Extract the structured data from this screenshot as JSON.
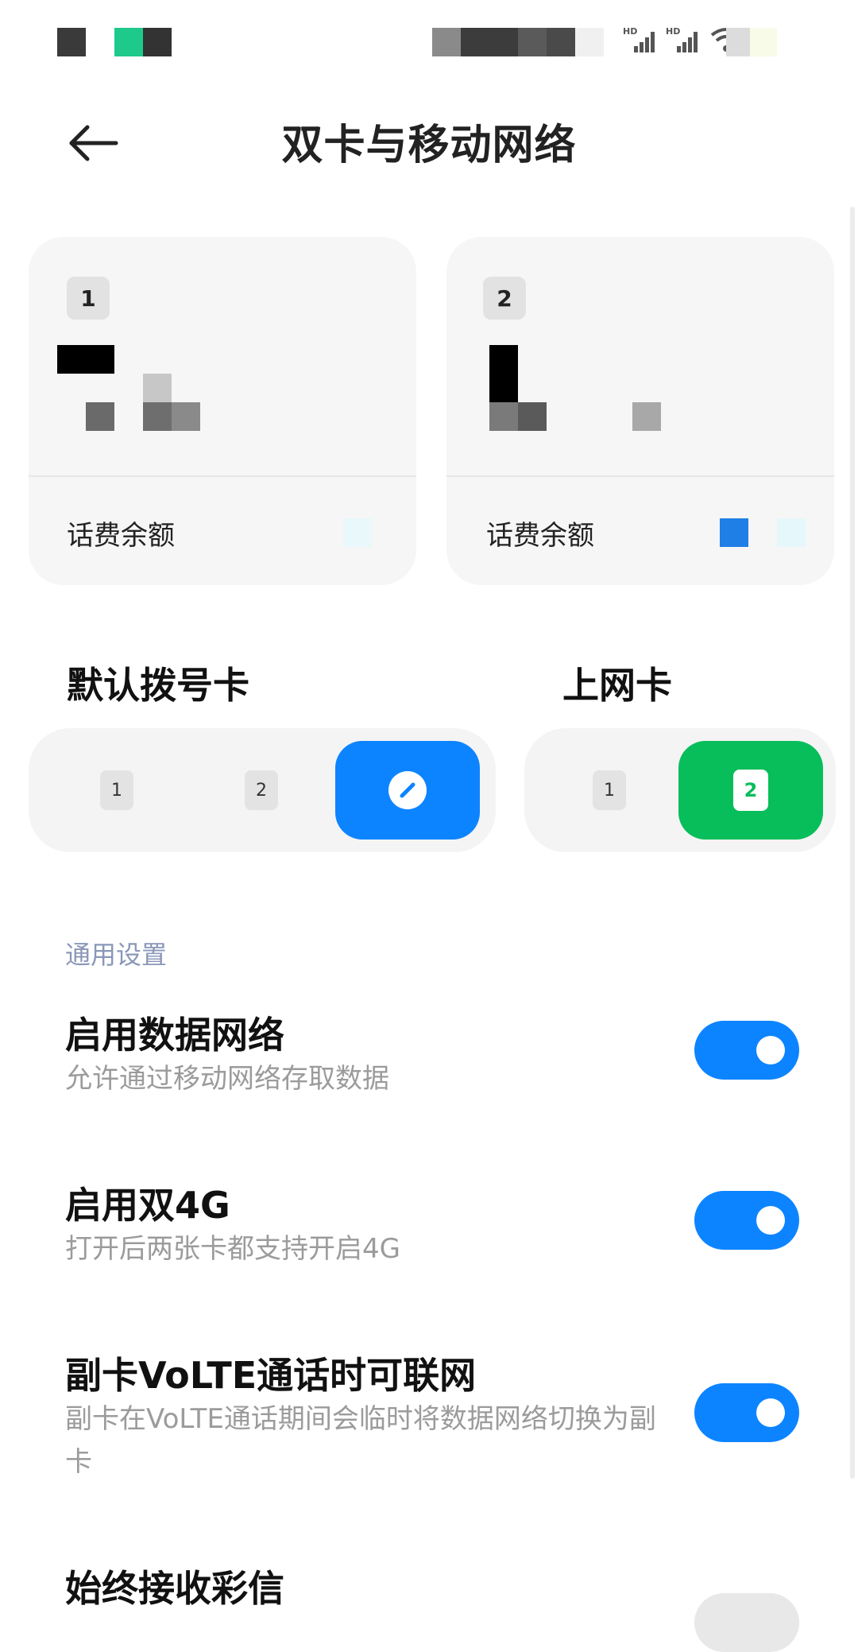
{
  "header": {
    "title": "双卡与移动网络"
  },
  "sims": [
    {
      "slot": "1",
      "balance_label": "话费余额"
    },
    {
      "slot": "2",
      "balance_label": "话费余额"
    }
  ],
  "default_dial": {
    "label": "默认拨号卡",
    "options": [
      "1",
      "2"
    ],
    "selected": "ask"
  },
  "data_sim": {
    "label": "上网卡",
    "options": [
      "1",
      "2"
    ],
    "selected": "2"
  },
  "general": {
    "label": "通用设置",
    "items": [
      {
        "title": "启用数据网络",
        "subtitle": "允许通过移动网络存取数据",
        "on": true
      },
      {
        "title": "启用双4G",
        "subtitle": "打开后两张卡都支持开启4G",
        "on": true
      },
      {
        "title": "副卡VoLTE通话时可联网",
        "subtitle": "副卡在VoLTE通话期间会临时将数据网络切换为副卡",
        "on": true
      },
      {
        "title": "始终接收彩信",
        "subtitle": "",
        "on": false
      }
    ]
  },
  "colors": {
    "accent": "#0d84ff",
    "green": "#07be5a",
    "group_label": "#8a97b8"
  },
  "status_bar": {
    "icons": [
      "hd-signal-icon",
      "hd-signal-icon",
      "wifi-icon"
    ]
  }
}
